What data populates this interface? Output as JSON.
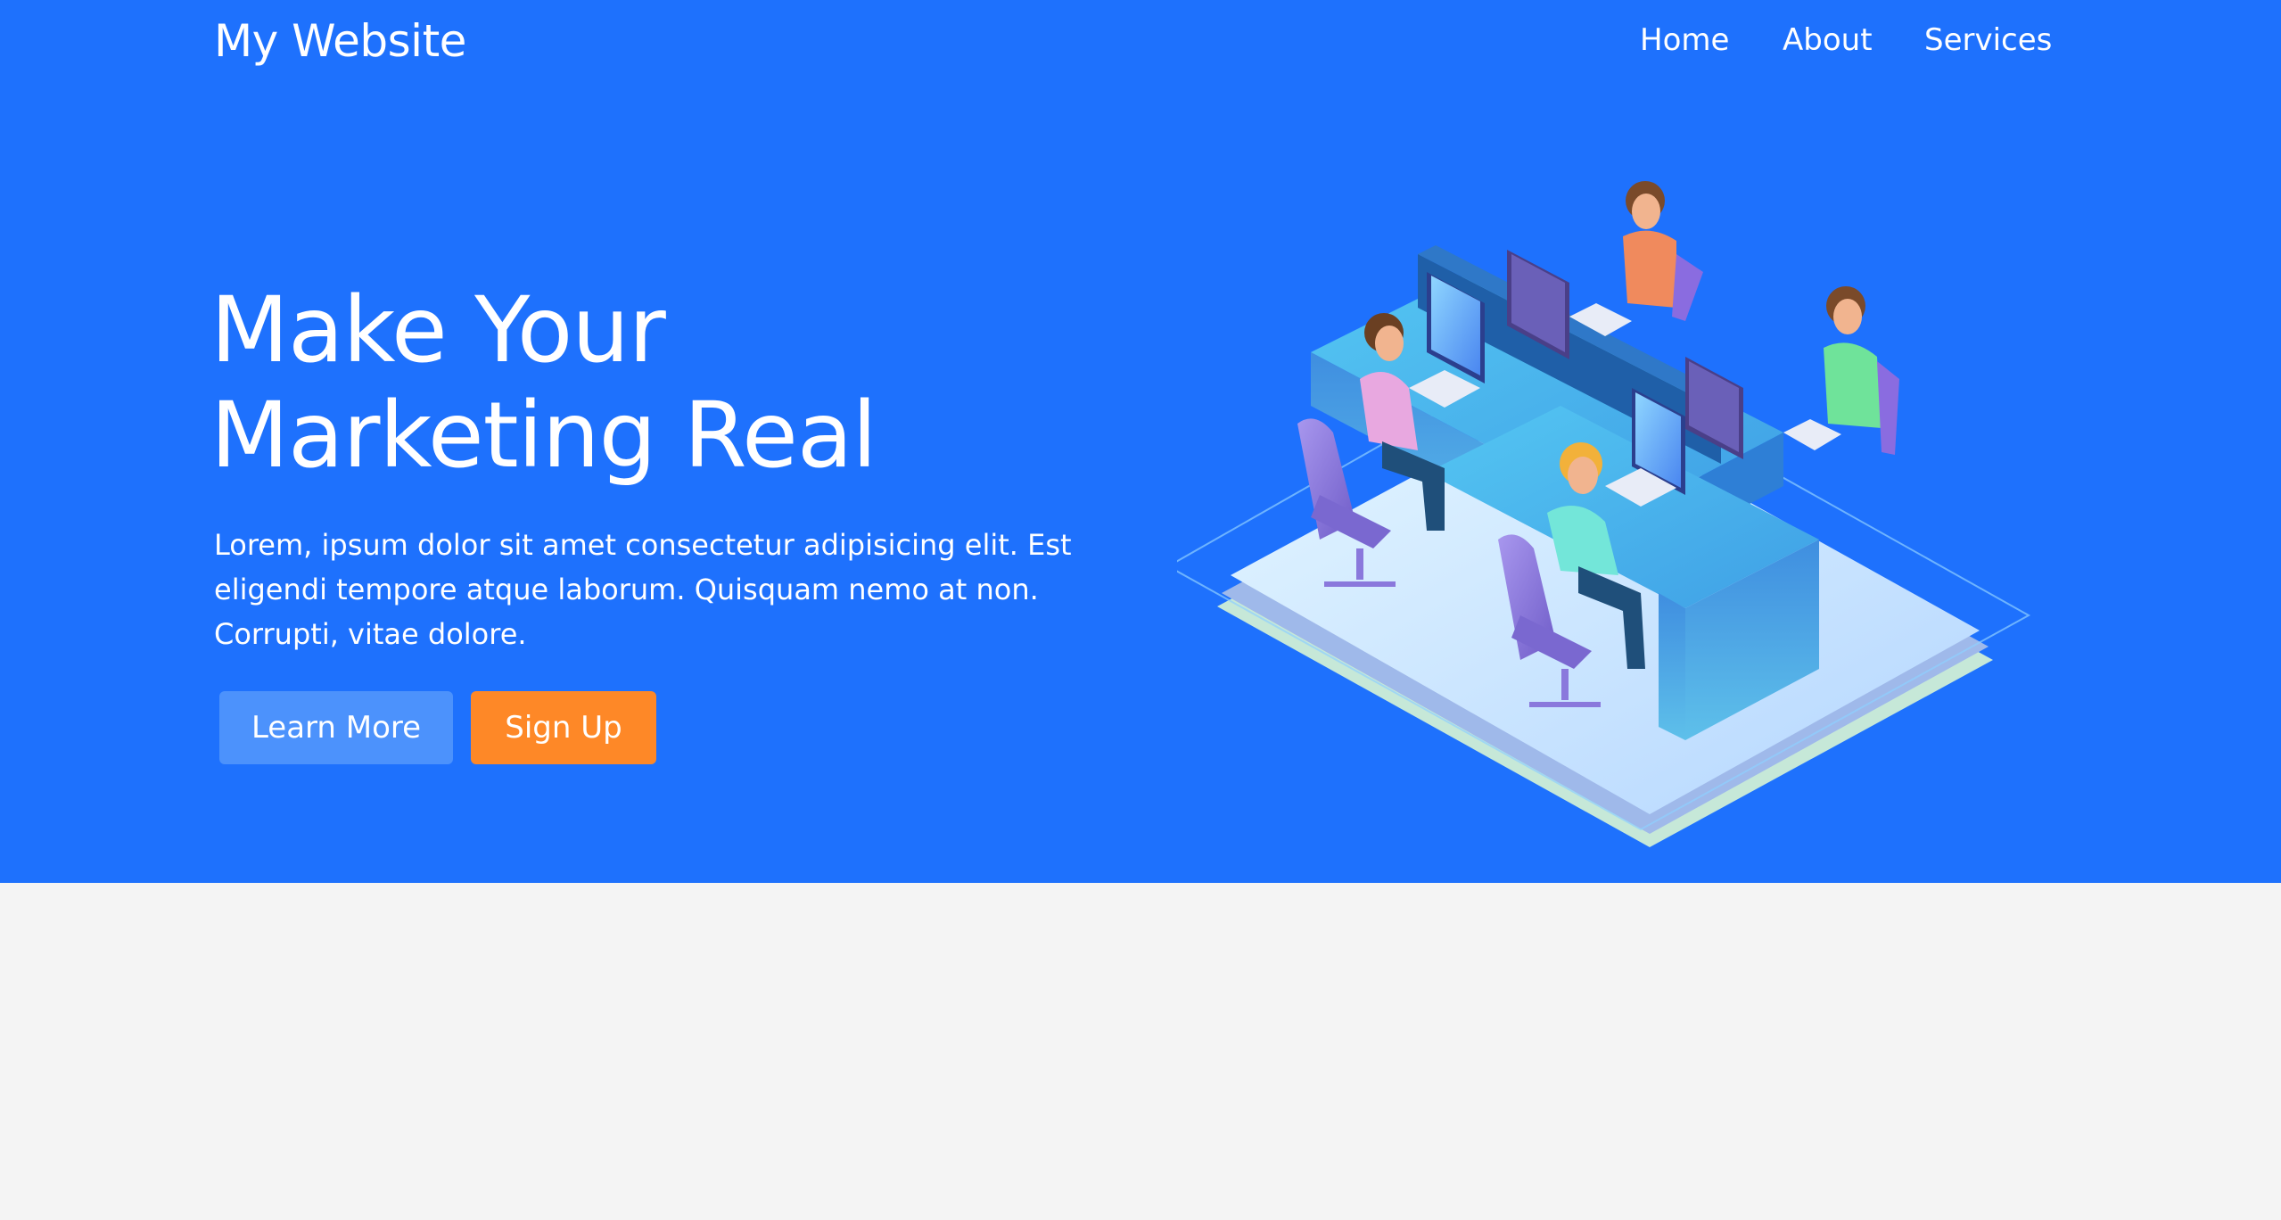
{
  "brand": {
    "name": "My Website"
  },
  "nav": {
    "items": [
      {
        "label": "Home"
      },
      {
        "label": "About"
      },
      {
        "label": "Services"
      }
    ]
  },
  "hero": {
    "headline_line1": "Make Your",
    "headline_line2": "Marketing Real",
    "paragraph_line1": "Lorem, ipsum dolor sit amet consectetur adipisicing elit. Est",
    "paragraph_line2": "eligendi tempore atque laborum. Quisquam nemo at non.",
    "paragraph_line3": "Corrupti, vitae dolore.",
    "learn_more_label": "Learn More",
    "sign_up_label": "Sign Up"
  },
  "colors": {
    "hero_background": "#1e71fd",
    "page_background": "#f4f4f4",
    "learn_more_button": "#4c92fc",
    "sign_up_button": "#fe8827",
    "text": "#ffffff"
  },
  "illustration": {
    "icon": "office-team-illustration"
  }
}
